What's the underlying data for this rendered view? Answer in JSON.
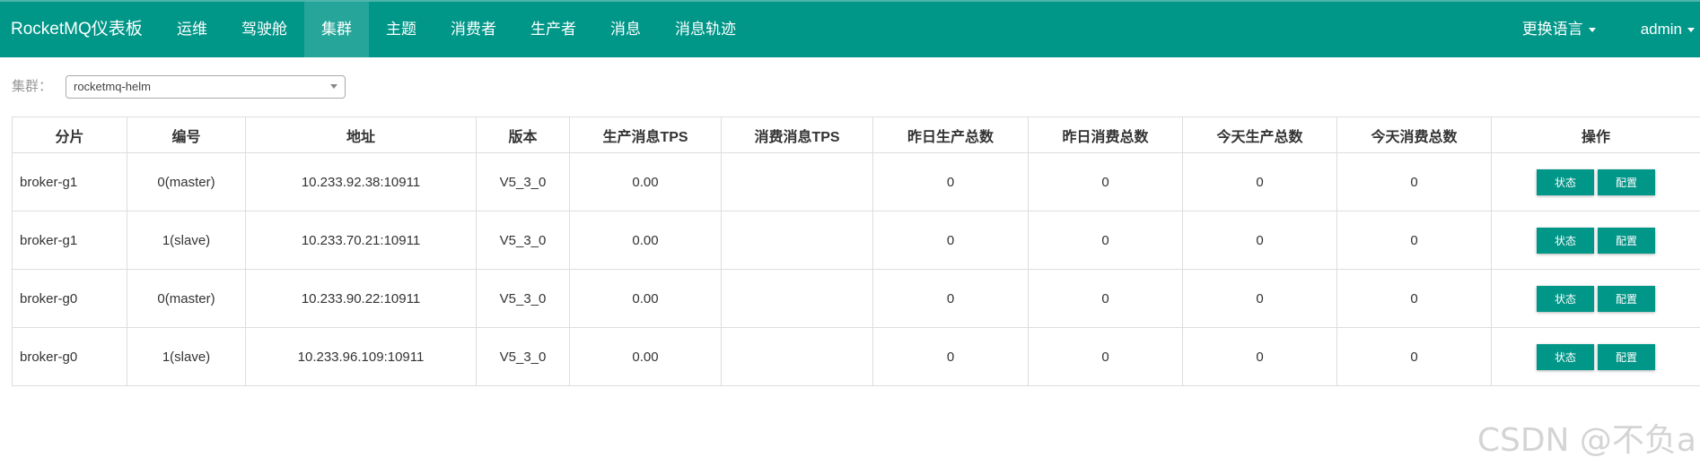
{
  "navbar": {
    "brand": "RocketMQ仪表板",
    "items": [
      "运维",
      "驾驶舱",
      "集群",
      "主题",
      "消费者",
      "生产者",
      "消息",
      "消息轨迹"
    ],
    "active_index": 2,
    "language_label": "更换语言",
    "user_label": "admin",
    "background_color": "#009688"
  },
  "filter": {
    "label": "集群：",
    "selected_value": "rocketmq-helm"
  },
  "table": {
    "headers": [
      "分片",
      "编号",
      "地址",
      "版本",
      "生产消息TPS",
      "消费消息TPS",
      "昨日生产总数",
      "昨日消费总数",
      "今天生产总数",
      "今天消费总数",
      "操作"
    ],
    "status_button": "状态",
    "config_button": "配置",
    "rows": [
      {
        "shard": "broker-g1",
        "id": "0(master)",
        "address": "10.233.92.38:10911",
        "version": "V5_3_0",
        "produce_tps": "0.00",
        "consume_tps": "",
        "yesterday_produce": "0",
        "yesterday_consume": "0",
        "today_produce": "0",
        "today_consume": "0"
      },
      {
        "shard": "broker-g1",
        "id": "1(slave)",
        "address": "10.233.70.21:10911",
        "version": "V5_3_0",
        "produce_tps": "0.00",
        "consume_tps": "",
        "yesterday_produce": "0",
        "yesterday_consume": "0",
        "today_produce": "0",
        "today_consume": "0"
      },
      {
        "shard": "broker-g0",
        "id": "0(master)",
        "address": "10.233.90.22:10911",
        "version": "V5_3_0",
        "produce_tps": "0.00",
        "consume_tps": "",
        "yesterday_produce": "0",
        "yesterday_consume": "0",
        "today_produce": "0",
        "today_consume": "0"
      },
      {
        "shard": "broker-g0",
        "id": "1(slave)",
        "address": "10.233.96.109:10911",
        "version": "V5_3_0",
        "produce_tps": "0.00",
        "consume_tps": "",
        "yesterday_produce": "0",
        "yesterday_consume": "0",
        "today_produce": "0",
        "today_consume": "0"
      }
    ]
  },
  "watermark": "CSDN @不负a"
}
